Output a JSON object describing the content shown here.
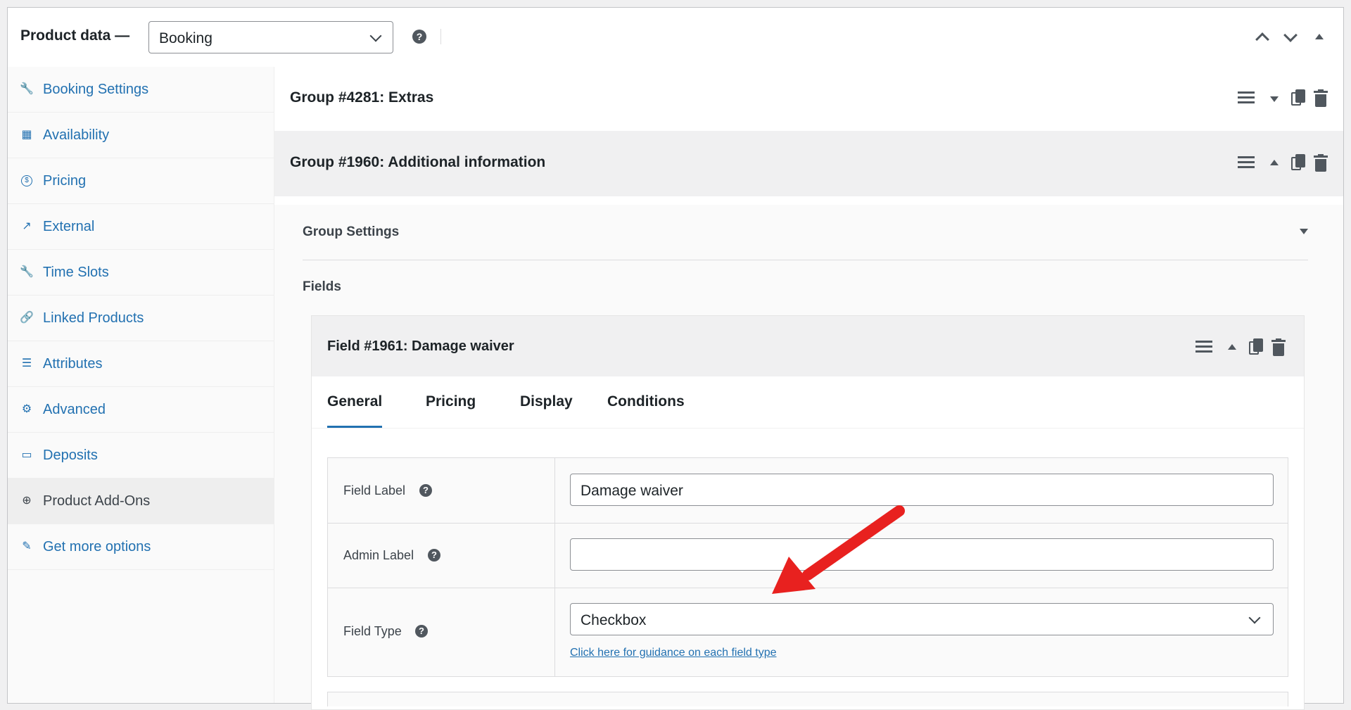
{
  "header": {
    "title": "Product data —",
    "product_type": "Booking",
    "help": "?"
  },
  "sidebar": {
    "items": [
      {
        "label": "Booking Settings",
        "icon": "wrench-icon",
        "glyph": "🔧",
        "active": false
      },
      {
        "label": "Availability",
        "icon": "calendar-icon",
        "glyph": "▦",
        "active": false
      },
      {
        "label": "Pricing",
        "icon": "dollar-circle-icon",
        "glyph": "$",
        "active": false
      },
      {
        "label": "External",
        "icon": "external-link-icon",
        "glyph": "↗",
        "active": false
      },
      {
        "label": "Time Slots",
        "icon": "wrench-icon",
        "glyph": "🔧",
        "active": false
      },
      {
        "label": "Linked Products",
        "icon": "link-icon",
        "glyph": "🔗",
        "active": false
      },
      {
        "label": "Attributes",
        "icon": "list-table-icon",
        "glyph": "☰",
        "active": false
      },
      {
        "label": "Advanced",
        "icon": "gear-icon",
        "glyph": "⚙",
        "active": false
      },
      {
        "label": "Deposits",
        "icon": "card-icon",
        "glyph": "▭",
        "active": false
      },
      {
        "label": "Product Add-Ons",
        "icon": "plus-circle-icon",
        "glyph": "⊕",
        "active": true
      },
      {
        "label": "Get more options",
        "icon": "plugin-icon",
        "glyph": "✎",
        "active": false
      }
    ]
  },
  "groups": [
    {
      "title": "Group #4281: Extras",
      "expanded": false
    },
    {
      "title": "Group #1960: Additional information",
      "expanded": true
    }
  ],
  "group_settings_label": "Group Settings",
  "fields_label": "Fields",
  "field": {
    "title": "Field #1961: Damage waiver",
    "tabs": [
      "General",
      "Pricing",
      "Display",
      "Conditions"
    ],
    "active_tab": "General",
    "rows": {
      "field_label": {
        "label": "Field Label",
        "value": "Damage waiver"
      },
      "admin_label": {
        "label": "Admin Label",
        "value": ""
      },
      "field_type": {
        "label": "Field Type",
        "value": "Checkbox",
        "link": "Click here for guidance on each field type"
      }
    }
  },
  "colors": {
    "accent": "#2271b1",
    "annotation_arrow": "#e8211f"
  }
}
